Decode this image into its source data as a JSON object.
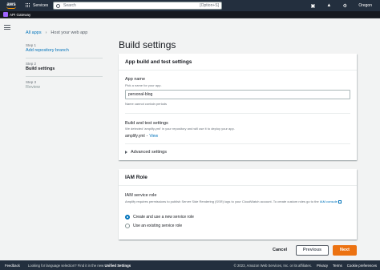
{
  "topnav": {
    "logo_text": "aws",
    "services_label": "Services",
    "search_placeholder": "Search",
    "search_shortcut": "[Option+S]",
    "region": "Oregon"
  },
  "subnav": {
    "service_label": "API Gateway"
  },
  "breadcrumb": {
    "root": "All apps",
    "current": "Host your web app"
  },
  "steps": [
    {
      "num": "Step 1",
      "name": "Add repository branch",
      "state": "link"
    },
    {
      "num": "Step 2",
      "name": "Build settings",
      "state": "active"
    },
    {
      "num": "Step 3",
      "name": "Review",
      "state": "disabled"
    }
  ],
  "page_title": "Build settings",
  "panel_build": {
    "header": "App build and test settings",
    "app_name_label": "App name",
    "app_name_desc": "Pick a name for your app.",
    "app_name_value": "personal-blog",
    "app_name_constraint": "Name cannot contain periods",
    "build_label": "Build and test settings",
    "build_desc": "We detected 'amplify.yml' in your repository and will use it to deploy your app.",
    "yml_file": "amplify.yml",
    "yml_sep": "-",
    "yml_view": "View",
    "advanced": "Advanced settings"
  },
  "panel_iam": {
    "header": "IAM Role",
    "service_role_label": "IAM service role",
    "service_role_desc": "Amplify requires permissions to publish Server Side Rendering (SSR) logs to your CloudWatch account. To create custom roles go to the",
    "iam_console_link": "IAM console",
    "options": [
      {
        "label": "Create and use a new service role",
        "selected": true
      },
      {
        "label": "Use an existing service role",
        "selected": false
      }
    ]
  },
  "buttons": {
    "cancel": "Cancel",
    "previous": "Previous",
    "next": "Next"
  },
  "footer": {
    "feedback": "Feedback",
    "lang_text": "Looking for language selection? Find it in the new",
    "lang_link": "Unified Settings",
    "copyright": "© 2023, Amazon Web Services, Inc. or its affiliates.",
    "privacy": "Privacy",
    "terms": "Terms",
    "cookies": "Cookie preferences"
  },
  "colors": {
    "accent": "#ec7211",
    "link": "#0073bb",
    "nav": "#232f3e"
  }
}
